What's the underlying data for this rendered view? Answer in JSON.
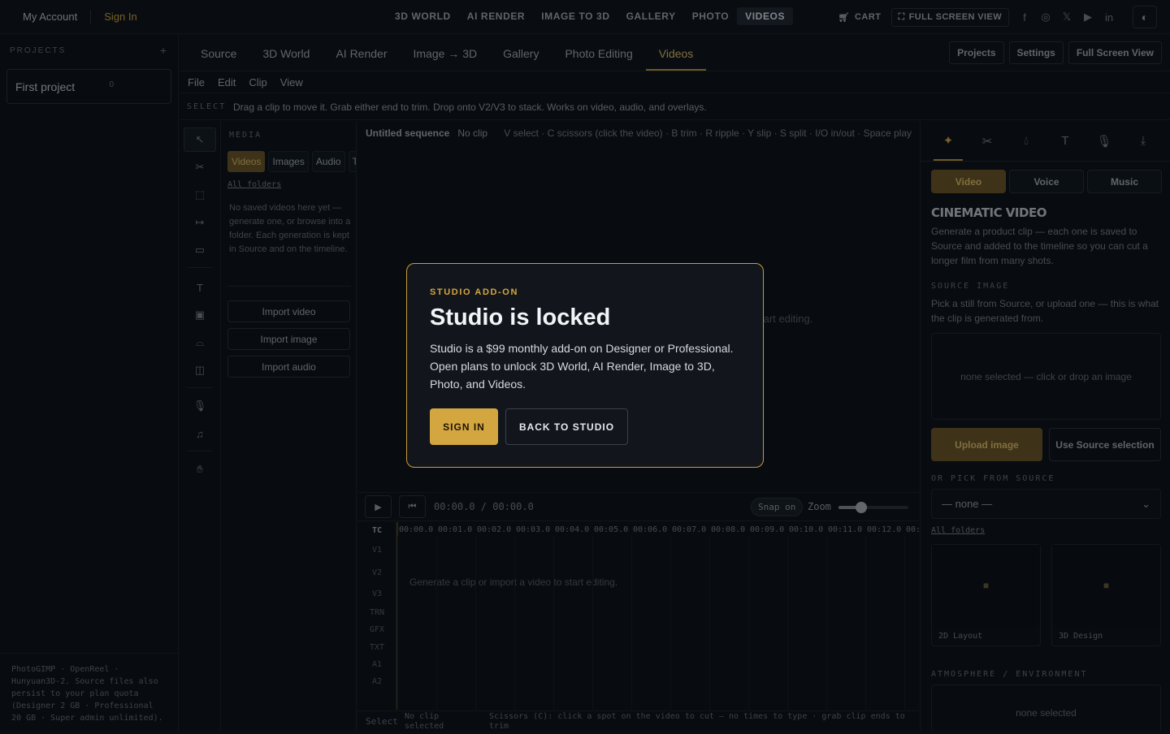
{
  "topnav": {
    "account": "My Account",
    "sign_in": "Sign In",
    "items": [
      "3D WORLD",
      "AI RENDER",
      "IMAGE TO 3D",
      "GALLERY",
      "PHOTO",
      "VIDEOS"
    ],
    "active_item": "VIDEOS",
    "cart": "CART",
    "full_screen": "FULL SCREEN VIEW"
  },
  "sidebar": {
    "heading": "PROJECTS",
    "add": "+",
    "project_name": "First project",
    "project_index": "0",
    "footer": "PhotoGIMP · OpenReel · Hunyuan3D-2. Source files also persist to your plan quota (Designer 2 GB · Professional 20 GB · Super admin unlimited)."
  },
  "tabs": {
    "items": [
      "Source",
      "3D World",
      "AI Render",
      "Image → 3D",
      "Gallery",
      "Photo Editing",
      "Videos"
    ],
    "active": "Videos",
    "right": [
      "Projects",
      "Settings",
      "Full Screen View"
    ]
  },
  "menu": [
    "File",
    "Edit",
    "Clip",
    "View"
  ],
  "hintbar": {
    "mode": "SELECT",
    "hint": "Drag a clip to move it. Grab either end to trim. Drop onto V2/V3 to stack. Works on video, audio, and overlays."
  },
  "media": {
    "heading": "MEDIA",
    "tabs": [
      "Videos",
      "Images",
      "Audio",
      "T"
    ],
    "active_tab": "Videos",
    "all_folders": "All folders",
    "empty": "No saved videos here yet — generate one, or browse into a folder. Each generation is kept in Source and on the timeline.",
    "import_video": "Import video",
    "import_image": "Import image",
    "import_audio": "Import audio"
  },
  "viewer": {
    "sequence": "Untitled sequence",
    "clip": "No clip",
    "keys": "V select · C scissors (click the video) · B trim · R ripple · Y slip · S split · I/O in/out · Space play",
    "partial": "tart editing."
  },
  "transport": {
    "timecode": "00:00.0 / 00:00.0",
    "snap": "Snap on",
    "zoom_label": "Zoom",
    "zoom_level": 0.33
  },
  "timeline": {
    "tracks": [
      "TC",
      "V1",
      "V2",
      "V3",
      "TRN",
      "GFX",
      "TXT",
      "A1",
      "A2"
    ],
    "ticks": [
      "00:00.0",
      "00:01.0",
      "00:02.0",
      "00:03.0",
      "00:04.0",
      "00:05.0",
      "00:06.0",
      "00:07.0",
      "00:08.0",
      "00:09.0",
      "00:10.0",
      "00:11.0",
      "00:12.0",
      "00:"
    ],
    "empty": "Generate a clip or import a video to start editing.",
    "status_mode": "Select",
    "status_clip": "No clip selected",
    "status_hint": "Scissors (C): click a spot on the video to cut — no times to type · grab clip ends to trim"
  },
  "rpanel": {
    "tabs": [
      "Video",
      "Voice",
      "Music"
    ],
    "active_tab": "Video",
    "title": "CINEMATIC VIDEO",
    "desc": "Generate a product clip — each one is saved to Source and added to the timeline so you can cut a longer film from many shots.",
    "source_label": "SOURCE IMAGE",
    "source_desc": "Pick a still from Source, or upload one — this is what the clip is generated from.",
    "drop": "none selected — click or drop an image",
    "upload": "Upload image",
    "use_source": "Use Source selection",
    "pick_label": "OR PICK FROM SOURCE",
    "pick_value": "— none —",
    "all_folders": "All folders",
    "folders": [
      "2D Layout",
      "3D Design"
    ],
    "atmos_label": "ATMOSPHERE / ENVIRONMENT",
    "atmos_value": "none selected"
  },
  "modal": {
    "eyebrow": "STUDIO ADD-ON",
    "title": "Studio is locked",
    "body": "Studio is a $99 monthly add-on on Designer or Professional. Open plans to unlock 3D World, AI Render, Image to 3D, Photo, and Videos.",
    "sign_in": "SIGN IN",
    "back": "BACK TO STUDIO"
  },
  "colors": {
    "accent": "#d4a640",
    "accent_dark": "#6d5623",
    "bg": "#0b0f14"
  }
}
